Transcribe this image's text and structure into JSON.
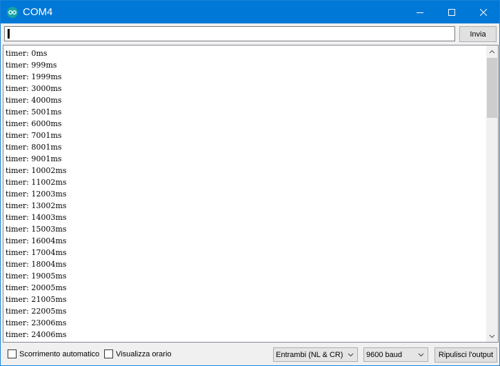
{
  "window": {
    "title": "COM4",
    "title_bar_color": "#0078d7",
    "icons": [
      "arduino-icon",
      "minimize-icon",
      "maximize-icon",
      "close-icon"
    ]
  },
  "send": {
    "input_value": "",
    "button_label": "Invia"
  },
  "output": {
    "lines": [
      "timer: 0ms",
      "timer: 999ms",
      "timer: 1999ms",
      "timer: 3000ms",
      "timer: 4000ms",
      "timer: 5001ms",
      "timer: 6000ms",
      "timer: 7001ms",
      "timer: 8001ms",
      "timer: 9001ms",
      "timer: 10002ms",
      "timer: 11002ms",
      "timer: 12003ms",
      "timer: 13002ms",
      "timer: 14003ms",
      "timer: 15003ms",
      "timer: 16004ms",
      "timer: 17004ms",
      "timer: 18004ms",
      "timer: 19005ms",
      "timer: 20005ms",
      "timer: 21005ms",
      "timer: 22005ms",
      "timer: 23006ms",
      "timer: 24006ms"
    ]
  },
  "bottom": {
    "autoscroll_label": "Scorrimento automatico",
    "autoscroll_checked": false,
    "timestamp_label": "Visualizza orario",
    "timestamp_checked": false,
    "line_ending_selected": "Entrambi (NL & CR)",
    "baud_selected": "9600 baud",
    "clear_label": "Ripulisci l'output"
  }
}
